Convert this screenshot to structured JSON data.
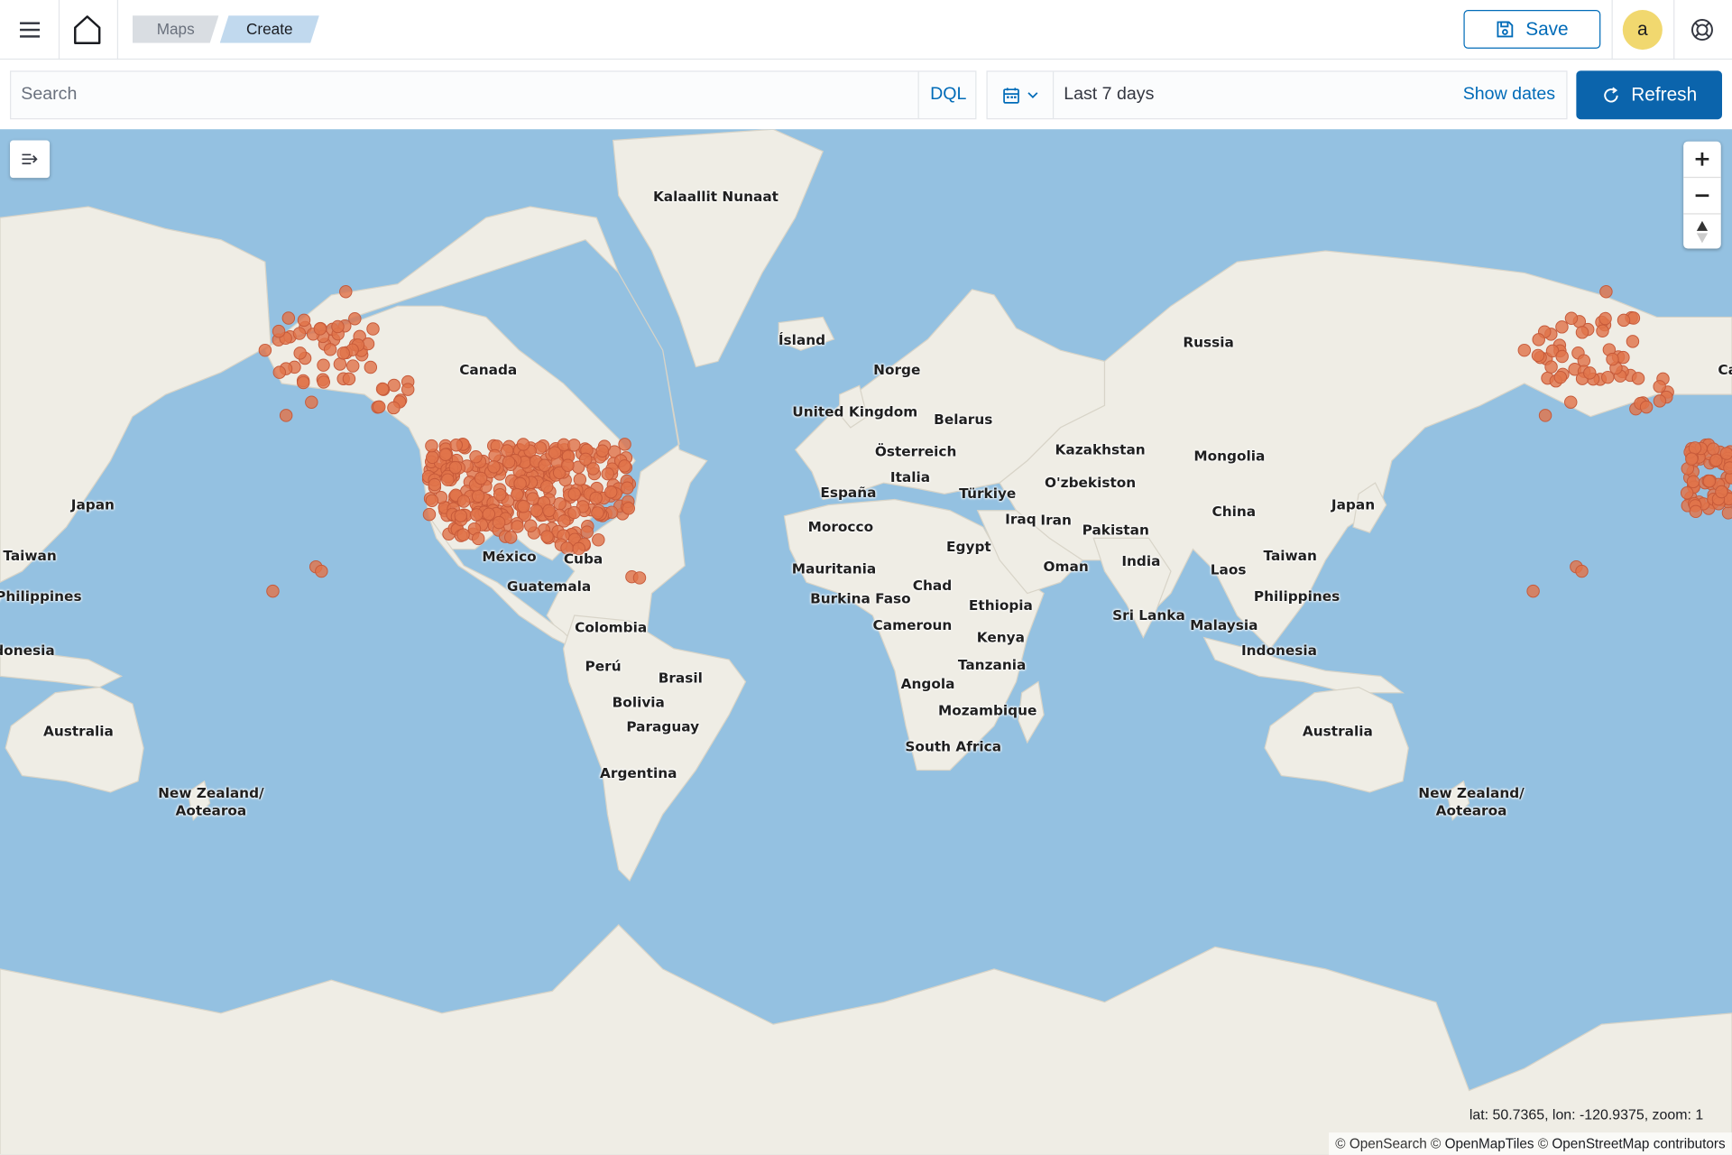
{
  "header": {
    "breadcrumbs": [
      "Maps",
      "Create"
    ],
    "save_label": "Save",
    "avatar_initial": "a"
  },
  "query": {
    "search_placeholder": "Search",
    "language": "DQL",
    "date_range": "Last 7 days",
    "show_dates": "Show dates",
    "refresh_label": "Refresh"
  },
  "map": {
    "labels": [
      "Kalaallit Nunaat",
      "Ísland",
      "Canada",
      "Russia",
      "Norge",
      "United Kingdom",
      "Belarus",
      "Kazakhstan",
      "Mongolia",
      "Österreich",
      "Italia",
      "España",
      "Türkiye",
      "O'zbekiston",
      "Japan",
      "China",
      "Iraq",
      "Iran",
      "Pakistan",
      "Morocco",
      "Egypt",
      "Taiwan",
      "México",
      "Cuba",
      "Mauritania",
      "Chad",
      "Oman",
      "India",
      "Laos",
      "Philippines",
      "Guatemala",
      "Burkina Faso",
      "Ethiopia",
      "Sri Lanka",
      "Malaysia",
      "Colombia",
      "Cameroun",
      "Kenya",
      "Indonesia",
      "Perú",
      "Brasil",
      "Tanzania",
      "Bolivia",
      "Angola",
      "Paraguay",
      "Mozambique",
      "Australia",
      "South Africa",
      "Argentina",
      "New Zealand/ Aotearoa",
      "Japan",
      "Taiwan",
      "Philippines",
      "Australia",
      "New Zealand/ Aotearoa",
      "Ca",
      "donesia"
    ],
    "status": "lat: 50.7365, lon: -120.9375, zoom: 1",
    "attribution": [
      "© OpenSearch",
      "©",
      "OpenMapTiles",
      "©",
      "OpenStreetMap contributors"
    ],
    "marker_color": "#e0744a",
    "water_color": "#94c1e1",
    "land_color": "#efede5"
  }
}
